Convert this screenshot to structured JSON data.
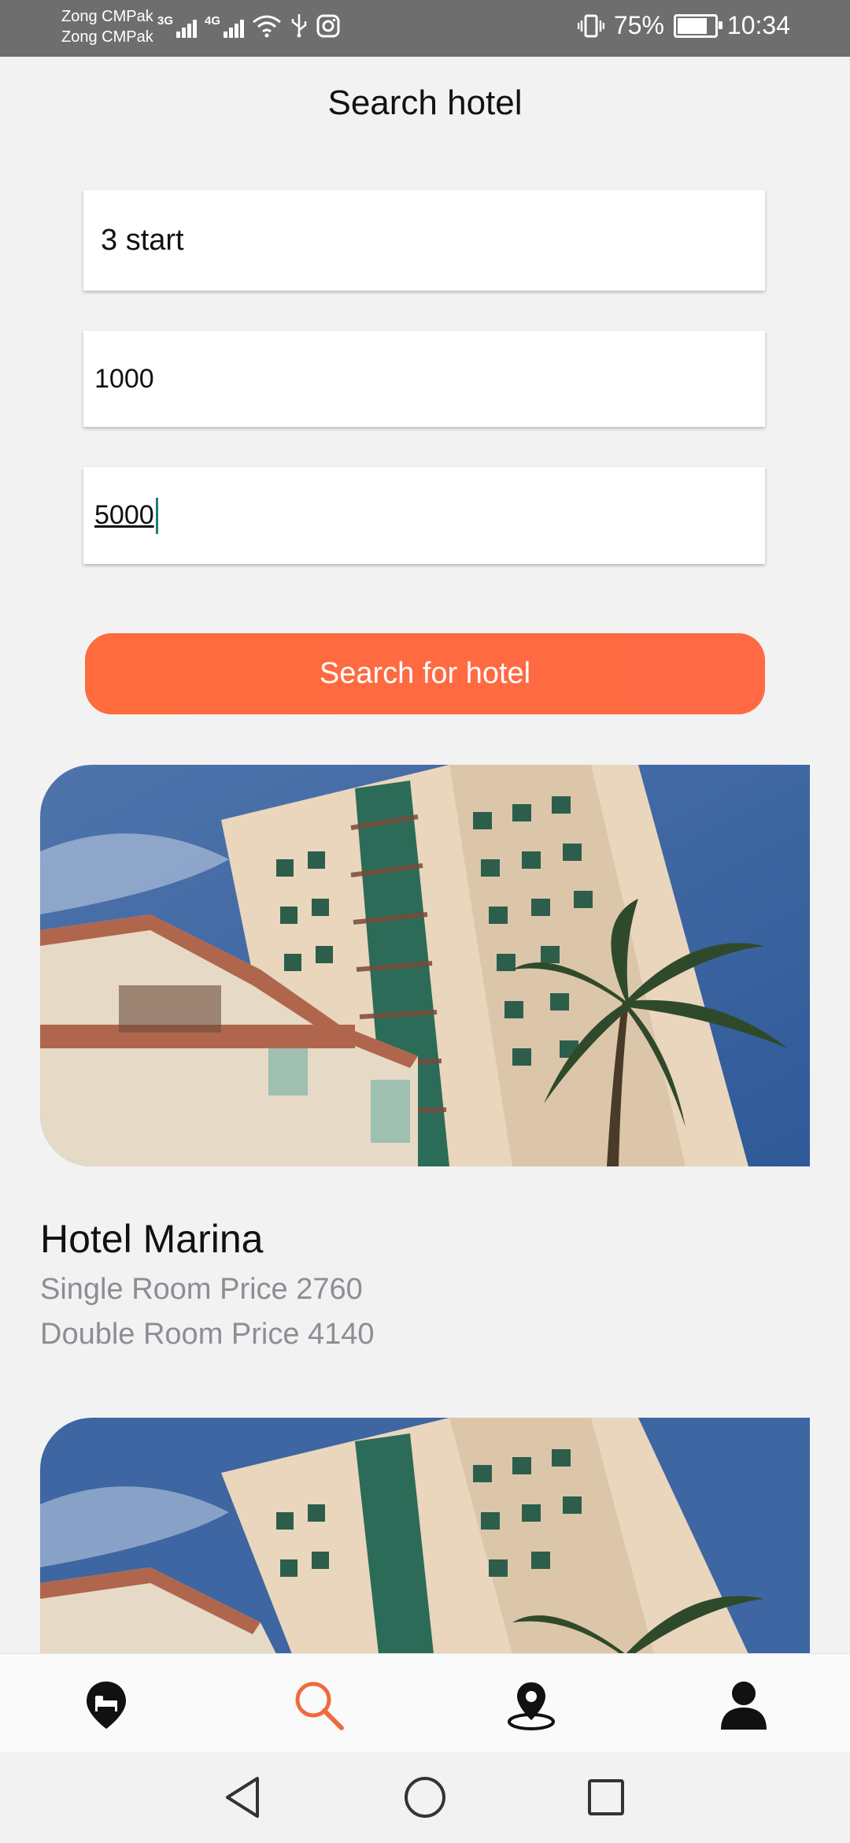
{
  "status_bar": {
    "carrier_1": "Zong CMPak",
    "carrier_2": "Zong CMPak",
    "net_1": "3G",
    "net_2": "4G",
    "battery_percent": "75%",
    "battery_level": 0.75,
    "time": "10:34"
  },
  "header": {
    "title": "Search hotel"
  },
  "form": {
    "rating_value": "3 start",
    "min_price_value": "1000",
    "max_price_value": "5000",
    "search_button_label": "Search for hotel"
  },
  "results": [
    {
      "name": "Hotel Marina",
      "single_price": "Single Room Price 2760",
      "double_price": "Double Room Price 4140"
    }
  ],
  "bottom_nav": {
    "items": [
      "hotel-pin-icon",
      "search-icon",
      "location-pin-icon",
      "person-icon"
    ],
    "active_index": 1,
    "active_color": "#f06a3d"
  },
  "colors": {
    "accent": "#ff6b40",
    "background": "#f2f2f2",
    "muted_text": "#8d8d95"
  }
}
